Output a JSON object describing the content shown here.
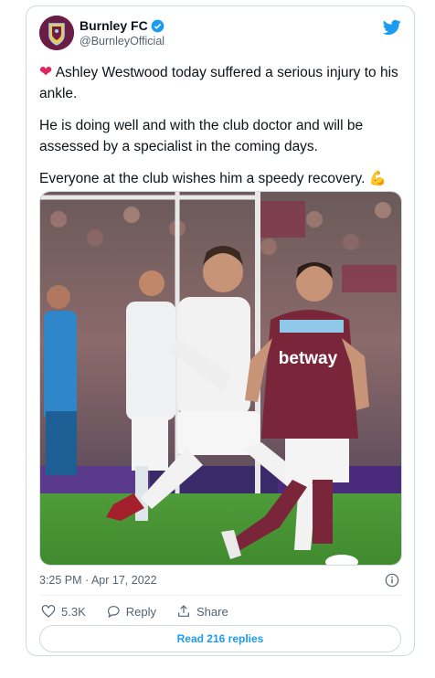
{
  "tweet": {
    "author": {
      "name": "Burnley FC",
      "handle": "@BurnleyOfficial",
      "verified": true,
      "avatar_icon": "burnley-crest-icon"
    },
    "text": {
      "paragraph_1": "Ashley Westwood today suffered a serious injury to his ankle.",
      "paragraph_2": "He is doing well and with the club doctor and will be assessed by a specialist in the coming days.",
      "paragraph_3": "Everyone at the club wishes him a speedy recovery."
    },
    "emojis": {
      "heart": "❤",
      "flexed_biceps": "💪"
    },
    "media": {
      "sponsor_text": "betway",
      "description_icon": "football-match-photo"
    },
    "timestamp": "3:25 PM · Apr 17, 2022",
    "likes": "5.3K",
    "reply_label": "Reply",
    "share_label": "Share",
    "read_replies_label": "Read 216 replies"
  },
  "colors": {
    "accent": "#1d9bf0",
    "heart": "#f91880",
    "muted": "#536471",
    "burnley_claret": "#6c1d45",
    "westham_claret": "#7a263a"
  }
}
